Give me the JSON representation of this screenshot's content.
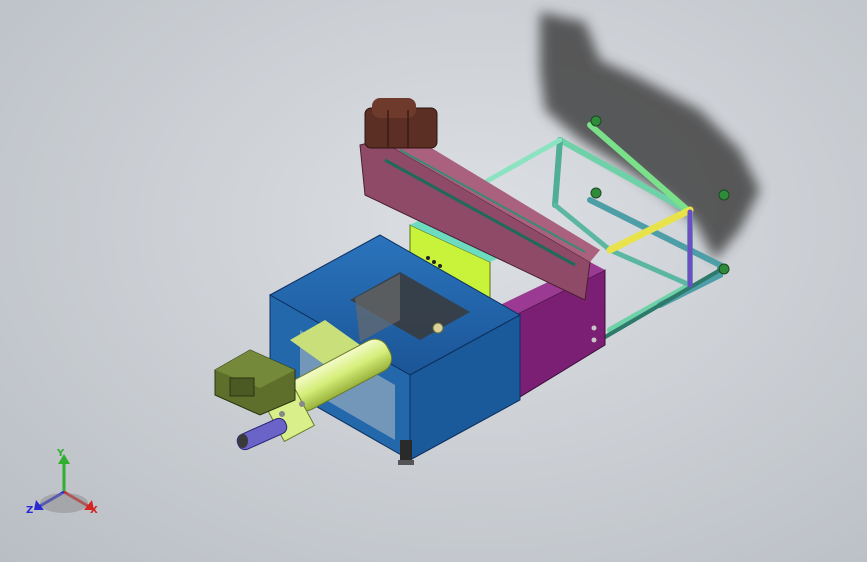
{
  "view": {
    "background_color": "#c9cdd2"
  },
  "model": {
    "parts": [
      {
        "name": "drive-motor",
        "color": "#5b2f23"
      },
      {
        "name": "top-beam",
        "color": "#8e4a66"
      },
      {
        "name": "guide-frame",
        "color": "#7cd7b8"
      },
      {
        "name": "yellow-crossbar",
        "color": "#e8e34a"
      },
      {
        "name": "blue-housing",
        "color": "#1f64a8"
      },
      {
        "name": "purple-side-panel",
        "color": "#7a1f74"
      },
      {
        "name": "lime-panel",
        "color": "#c9f23a"
      },
      {
        "name": "cylinder-body",
        "color": "#d9f08a"
      },
      {
        "name": "olive-gearbox",
        "color": "#5d6f2a"
      },
      {
        "name": "piston-rod",
        "color": "#6a63c8"
      }
    ]
  },
  "triad": {
    "axes": [
      {
        "label": "Y",
        "color": "#2fae2f"
      },
      {
        "label": "X",
        "color": "#d42424"
      },
      {
        "label": "Z",
        "color": "#2a2ad4"
      }
    ]
  }
}
